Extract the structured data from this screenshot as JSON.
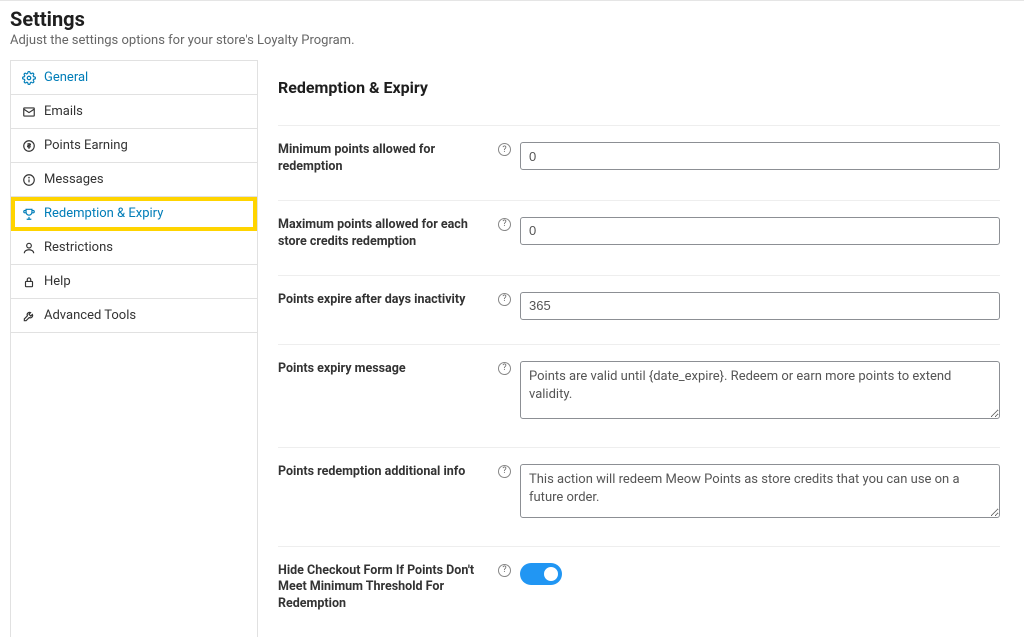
{
  "header": {
    "title": "Settings",
    "subtitle": "Adjust the settings options for your store's Loyalty Program."
  },
  "sidebar": {
    "items": [
      {
        "label": "General",
        "active": true,
        "highlighted": false,
        "icon": "gear-icon"
      },
      {
        "label": "Emails",
        "active": false,
        "highlighted": false,
        "icon": "mail-icon"
      },
      {
        "label": "Points Earning",
        "active": false,
        "highlighted": false,
        "icon": "dollar-icon"
      },
      {
        "label": "Messages",
        "active": false,
        "highlighted": false,
        "icon": "info-icon"
      },
      {
        "label": "Redemption & Expiry",
        "active": true,
        "highlighted": true,
        "icon": "trophy-icon"
      },
      {
        "label": "Restrictions",
        "active": false,
        "highlighted": false,
        "icon": "user-icon"
      },
      {
        "label": "Help",
        "active": false,
        "highlighted": false,
        "icon": "lock-icon"
      },
      {
        "label": "Advanced Tools",
        "active": false,
        "highlighted": false,
        "icon": "wrench-icon"
      }
    ]
  },
  "main": {
    "heading": "Redemption & Expiry",
    "fields": {
      "min_points": {
        "label": "Minimum points allowed for redemption",
        "value": "0"
      },
      "max_points": {
        "label": "Maximum points allowed for each store credits redemption",
        "value": "0"
      },
      "expire_days": {
        "label": "Points expire after days inactivity",
        "value": "365"
      },
      "expiry_msg": {
        "label": "Points expiry message",
        "value": "Points are valid until {date_expire}. Redeem or earn more points to extend validity."
      },
      "redeem_info": {
        "label": "Points redemption additional info",
        "value": "This action will redeem Meow Points as store credits that you can use on a future order."
      },
      "hide_checkout": {
        "label": "Hide Checkout Form If Points Don't Meet Minimum Threshold For Redemption",
        "value": true
      }
    }
  }
}
